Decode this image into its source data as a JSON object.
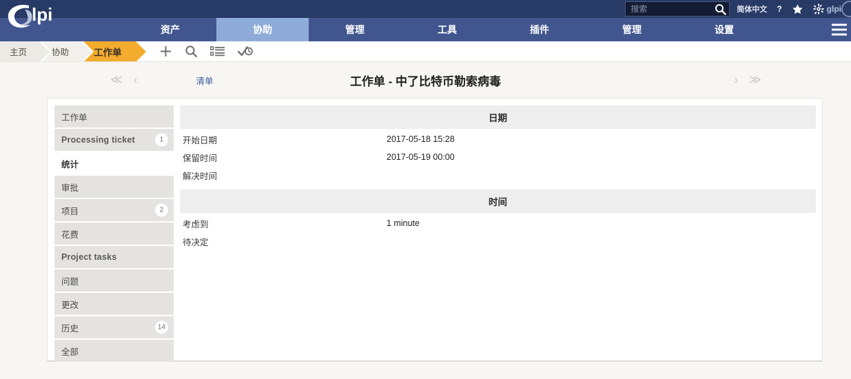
{
  "topbar": {
    "search_placeholder": "搜索",
    "search_value": "",
    "search_icon": "search-icon",
    "language": "简体中文",
    "help_icon": "?",
    "favorite_icon": "★",
    "settings_icon": "gear-icon",
    "username": "glpi"
  },
  "mainnav": {
    "items": [
      {
        "label": "资产",
        "active": false
      },
      {
        "label": "协助",
        "active": true
      },
      {
        "label": "管理",
        "active": false
      },
      {
        "label": "工具",
        "active": false
      },
      {
        "label": "插件",
        "active": false
      },
      {
        "label": "管理",
        "active": false
      },
      {
        "label": "设置",
        "active": false
      }
    ],
    "menu_icon": "hamburger-icon"
  },
  "breadcrumb": {
    "items": [
      {
        "label": "主页"
      },
      {
        "label": "协助"
      },
      {
        "label": "工作单"
      }
    ],
    "actions": [
      {
        "name": "add-icon"
      },
      {
        "name": "search-icon"
      },
      {
        "name": "list-icon"
      },
      {
        "name": "check-clock-icon"
      }
    ]
  },
  "titlebar": {
    "first_arrow": "≪",
    "prev_arrow": "‹",
    "list_link": "清单",
    "title": "工作单 - 中了比特币勒索病毒",
    "next_arrow": "›",
    "last_arrow": "≫"
  },
  "sidemenu": {
    "items": [
      {
        "label": "工作单",
        "badge": "",
        "active": false,
        "latin": false
      },
      {
        "label": "Processing ticket",
        "badge": "1",
        "active": false,
        "latin": true
      },
      {
        "label": "统计",
        "badge": "",
        "active": true,
        "latin": false
      },
      {
        "label": "审批",
        "badge": "",
        "active": false,
        "latin": false
      },
      {
        "label": "项目",
        "badge": "2",
        "active": false,
        "latin": false
      },
      {
        "label": "花费",
        "badge": "",
        "active": false,
        "latin": false
      },
      {
        "label": "Project tasks",
        "badge": "",
        "active": false,
        "latin": true
      },
      {
        "label": "问题",
        "badge": "",
        "active": false,
        "latin": false
      },
      {
        "label": "更改",
        "badge": "",
        "active": false,
        "latin": false
      },
      {
        "label": "历史",
        "badge": "14",
        "active": false,
        "latin": false
      },
      {
        "label": "全部",
        "badge": "",
        "active": false,
        "latin": false
      }
    ]
  },
  "sections": [
    {
      "heading": "日期",
      "rows": [
        {
          "label": "开始日期",
          "value": "2017-05-18 15:28"
        },
        {
          "label": "保留时间",
          "value": "2017-05-19 00:00"
        },
        {
          "label": "解决时间",
          "value": ""
        }
      ]
    },
    {
      "heading": "时间",
      "rows": [
        {
          "label": "考虑到",
          "value": "1 minute"
        },
        {
          "label": "待决定",
          "value": ""
        }
      ]
    }
  ],
  "colors": {
    "topbar_bg": "#283a66",
    "nav_bg": "#41568f",
    "nav_active_bg": "#8fabd9",
    "crumb_active_bg": "#f4ac2e",
    "page_bg": "#f7f6f2",
    "link_blue": "#3d5a9e",
    "section_head_bg": "#eeeeee",
    "side_item_bg": "#e4e3e1"
  }
}
